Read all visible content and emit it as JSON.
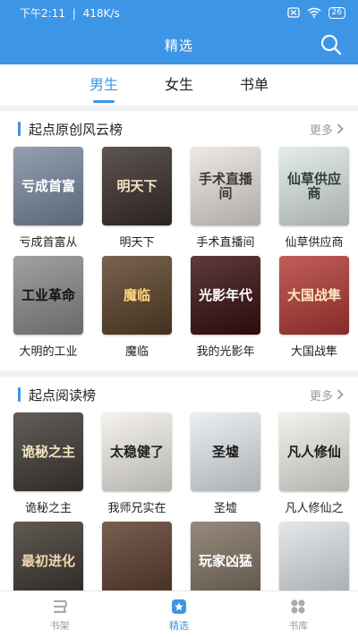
{
  "status_bar": {
    "time": "下午2:11",
    "speed": "418K/s",
    "battery": "26"
  },
  "header": {
    "title": "精选"
  },
  "tabs": [
    {
      "label": "男生",
      "active": true
    },
    {
      "label": "女生",
      "active": false
    },
    {
      "label": "书单",
      "active": false
    }
  ],
  "sections": [
    {
      "title": "起点原创风云榜",
      "more": "更多",
      "books": [
        {
          "title": "亏成首富从",
          "cover_text": "亏成首富",
          "bg": "#7a8aa0",
          "fg": "#ffffff"
        },
        {
          "title": "明天下",
          "cover_text": "明天下",
          "bg": "#3a2f2c",
          "fg": "#f4e2c2"
        },
        {
          "title": "手术直播间",
          "cover_text": "手术直播间",
          "bg": "#e9e4df",
          "fg": "#3a3a3a"
        },
        {
          "title": "仙草供应商",
          "cover_text": "仙草供应商",
          "bg": "#dfe9e6",
          "fg": "#2b3e3a"
        },
        {
          "title": "大明的工业",
          "cover_text": "工业革命",
          "bg": "#8c8c8c",
          "fg": "#111111"
        },
        {
          "title": "魔临",
          "cover_text": "魔临",
          "bg": "#5a4128",
          "fg": "#ffd680"
        },
        {
          "title": "我的光影年",
          "cover_text": "光影年代",
          "bg": "#3a0f10",
          "fg": "#ffffff"
        },
        {
          "title": "大国战隼",
          "cover_text": "大国战隼",
          "bg": "#b33a35",
          "fg": "#ffe9c0"
        }
      ]
    },
    {
      "title": "起点阅读榜",
      "more": "更多",
      "books": [
        {
          "title": "诡秘之主",
          "cover_text": "诡秘之主",
          "bg": "#3f3a35",
          "fg": "#f5e6c4"
        },
        {
          "title": "我师兄实在",
          "cover_text": "太稳健了",
          "bg": "#f3f0ea",
          "fg": "#222222"
        },
        {
          "title": "圣墟",
          "cover_text": "圣墟",
          "bg": "#e8ecef",
          "fg": "#1b1b1b"
        },
        {
          "title": "凡人修仙之",
          "cover_text": "凡人修仙",
          "bg": "#f1efe8",
          "fg": "#1b1b1b"
        },
        {
          "title": "最初进化",
          "cover_text": "最初进化",
          "bg": "#3d352e",
          "fg": "#f0d8b0"
        },
        {
          "title": "",
          "cover_text": "",
          "bg": "#5c3b2c",
          "fg": "#f0d8b0"
        },
        {
          "title": "玩家凶猛",
          "cover_text": "玩家凶猛",
          "bg": "#7e7060",
          "fg": "#ffffff"
        },
        {
          "title": "",
          "cover_text": "",
          "bg": "#dfe3e6",
          "fg": "#1b1b1b"
        }
      ]
    }
  ],
  "bottom_nav": [
    {
      "label": "书架",
      "icon": "bookshelf-icon",
      "active": false
    },
    {
      "label": "精选",
      "icon": "featured-icon",
      "active": true
    },
    {
      "label": "书库",
      "icon": "library-icon",
      "active": false
    }
  ],
  "colors": {
    "accent": "#3d95e6"
  }
}
